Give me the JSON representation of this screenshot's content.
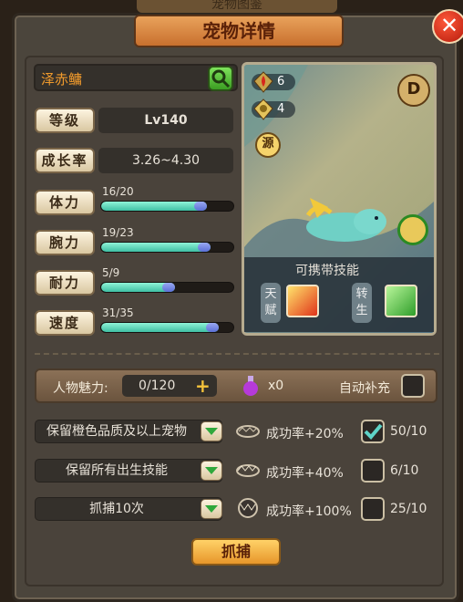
{
  "header": {
    "top_title": "宠物图鉴",
    "title": "宠物详情"
  },
  "pet": {
    "name": "泽赤鳙",
    "level_label": "等级",
    "level_value": "Lv140",
    "growth_label": "成长率",
    "growth_value": "3.26~4.30",
    "stats": [
      {
        "label": "体力",
        "text": "16/20",
        "fill": 0.8
      },
      {
        "label": "腕力",
        "text": "19/23",
        "fill": 0.83
      },
      {
        "label": "耐力",
        "text": "5/9",
        "fill": 0.56
      },
      {
        "label": "速度",
        "text": "31/35",
        "fill": 0.89
      }
    ]
  },
  "portrait": {
    "stat1": "6",
    "stat2": "4",
    "source_icon": "源",
    "skills_title": "可携带技能",
    "talent_label": "天赋",
    "rebirth_label": "转生"
  },
  "charm": {
    "label": "人物魅力:",
    "value": "0/120",
    "potion_count": "x0",
    "auto_label": "自动补充"
  },
  "options": [
    {
      "select": "保留橙色品质及以上宠物",
      "rate": "成功率+20%",
      "checked": true,
      "count": "50/10"
    },
    {
      "select": "保留所有出生技能",
      "rate": "成功率+40%",
      "checked": false,
      "count": "6/10"
    },
    {
      "select": "抓捕10次",
      "rate": "成功率+100%",
      "checked": false,
      "count": "25/10"
    }
  ],
  "capture_button": "抓捕",
  "colors": {
    "accent_orange": "#e7962a",
    "bar_green": "#3fbfa3",
    "bar_blue": "#5b6fd6"
  }
}
